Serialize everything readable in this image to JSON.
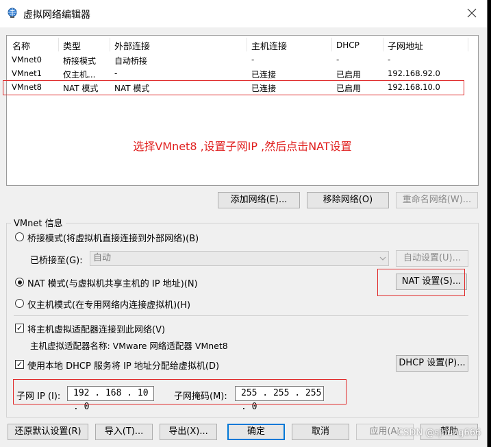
{
  "window": {
    "title": "虚拟网络编辑器"
  },
  "table": {
    "headers": [
      "名称",
      "类型",
      "外部连接",
      "主机连接",
      "DHCP",
      "子网地址"
    ],
    "rows": [
      {
        "name": "VMnet0",
        "type": "桥接模式",
        "external": "自动桥接",
        "host": "-",
        "dhcp": "-",
        "subnet": "-"
      },
      {
        "name": "VMnet1",
        "type": "仅主机...",
        "external": "-",
        "host": "已连接",
        "dhcp": "已启用",
        "subnet": "192.168.92.0"
      },
      {
        "name": "VMnet8",
        "type": "NAT 模式",
        "external": "NAT 模式",
        "host": "已连接",
        "dhcp": "已启用",
        "subnet": "192.168.10.0"
      }
    ],
    "annotation": "选择VMnet8 ,设置子网IP ,然后点击NAT设置"
  },
  "list_buttons": {
    "add": "添加网络(E)...",
    "remove": "移除网络(O)",
    "rename": "重命名网络(W)..."
  },
  "vmnet_info": {
    "group_label": "VMnet 信息",
    "bridged_label": "桥接模式(将虚拟机直接连接到外部网络)(B)",
    "bridged_to_label": "已桥接至(G):",
    "bridged_to_value": "自动",
    "auto_settings": "自动设置(U)...",
    "nat_label": "NAT 模式(与虚拟机共享主机的 IP 地址)(N)",
    "nat_settings": "NAT 设置(S)...",
    "hostonly_label": "仅主机模式(在专用网络内连接虚拟机)(H)",
    "connect_adapter_label": "将主机虚拟适配器连接到此网络(V)",
    "adapter_name": "主机虚拟适配器名称: VMware 网络适配器 VMnet8",
    "dhcp_label": "使用本地 DHCP 服务将 IP 地址分配给虚拟机(D)",
    "dhcp_settings": "DHCP 设置(P)...",
    "subnet_ip_label": "子网 IP (I):",
    "subnet_ip_value": "192 . 168 . 10 .  0",
    "subnet_mask_label": "子网掩码(M):",
    "subnet_mask_value": "255 . 255 . 255 .  0"
  },
  "bottom_buttons": {
    "restore": "还原默认设置(R)",
    "import": "导入(T)...",
    "export": "导出(X)...",
    "ok": "确定",
    "cancel": "取消",
    "apply": "应用(A)",
    "help": "帮助"
  },
  "watermark": "CSDN @sjhung666",
  "colors": {
    "annotation_red": "#e0201f",
    "focus_blue": "#0078d7"
  }
}
